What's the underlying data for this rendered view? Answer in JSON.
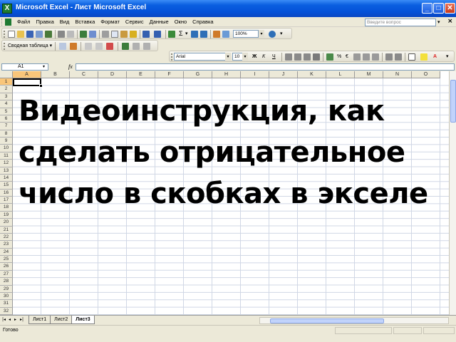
{
  "window": {
    "title": "Microsoft Excel - Лист Microsoft Excel",
    "app_icon": "X",
    "minimize": "_",
    "maximize": "□",
    "close": "✕",
    "doc_close": "×"
  },
  "menu": {
    "items": [
      "Файл",
      "Правка",
      "Вид",
      "Вставка",
      "Формат",
      "Сервис",
      "Данные",
      "Окно",
      "Справка"
    ],
    "help_placeholder": "Введите вопрос",
    "help_arrow": "▾"
  },
  "toolbar": {
    "zoom": "100%",
    "sum_icon": "Σ",
    "pivot_label": "Сводная таблица ▾",
    "font_name": "Arial",
    "font_size": "10",
    "bold": "Ж",
    "italic": "К",
    "underline": "Ч",
    "percent": "%",
    "currency": "€",
    "dropdown": "▾",
    "font_color_letter": "A"
  },
  "formula_bar": {
    "name_box": "A1",
    "fx": "fx",
    "dropdown": "▾",
    "value": ""
  },
  "columns": [
    "A",
    "B",
    "C",
    "D",
    "E",
    "F",
    "G",
    "H",
    "I",
    "J",
    "K",
    "L",
    "M",
    "N",
    "O"
  ],
  "active_cell": "A1",
  "row_count": 32,
  "overlay_text": {
    "line1": "Видеоинструкция, как",
    "line2": "сделать отрицательное",
    "line3": "число в скобках в экселе"
  },
  "sheet_tabs": {
    "nav": [
      "|◂",
      "◂",
      "▸",
      "▸|"
    ],
    "tabs": [
      "Лист1",
      "Лист2",
      "Лист3"
    ],
    "active": "Лист3"
  },
  "status": {
    "text": "Готово"
  },
  "colors": {
    "titlebar": "#0451d8",
    "header_highlight": "#f9c67a",
    "gridline": "#d0d7e5",
    "excel_green": "#1e7a32"
  }
}
